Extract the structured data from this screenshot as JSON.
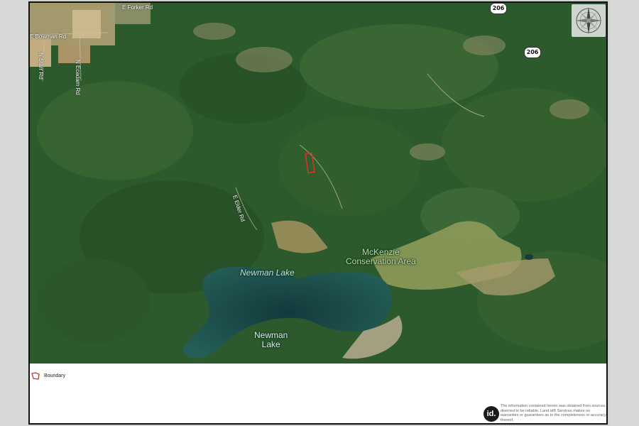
{
  "map": {
    "labels": {
      "newman_lake_water": "Newman Lake",
      "conservation_line1": "McKenzie",
      "conservation_line2": "Conservation Area",
      "newman_lake_line1": "Newman",
      "newman_lake_line2": "Lake"
    },
    "road_labels": {
      "elder_rd": "E Elder Rd",
      "bottom_left_rd": "E Bowman Rd",
      "vertical_rd": "N Ecadam Rd",
      "far_left_rd": "N Starr Rd",
      "top_rd": "E Forker Rd"
    },
    "route_shields": [
      "206",
      "206"
    ],
    "parcel_color": "#e0302a"
  },
  "legend": {
    "label": "Boundary",
    "swatch_color": "#c0392b"
  },
  "footer": {
    "logo_text": "id.",
    "disclaimer": "The information contained herein was obtained from sources deemed to be reliable. Land id® Services makes no warranties or guarantees as to the completeness or accuracy thereof."
  }
}
